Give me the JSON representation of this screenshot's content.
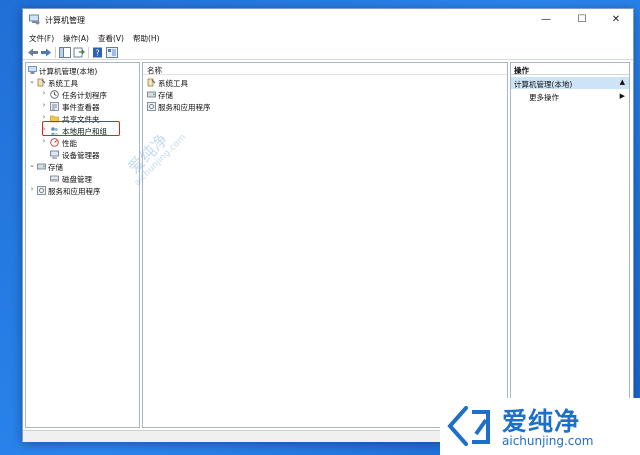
{
  "window": {
    "title": "计算机管理",
    "controls": {
      "minimize": "—",
      "maximize": "☐",
      "close": "✕"
    }
  },
  "menubar": [
    "文件(F)",
    "操作(A)",
    "查看(V)",
    "帮助(H)"
  ],
  "tree": {
    "root": "计算机管理(本地)",
    "system_tools": "系统工具",
    "task_scheduler": "任务计划程序",
    "event_viewer": "事件查看器",
    "shared_folders": "共享文件夹",
    "local_users": "本地用户和组",
    "performance": "性能",
    "device_manager": "设备管理器",
    "storage": "存储",
    "disk_management": "磁盘管理",
    "services_apps": "服务和应用程序"
  },
  "list": {
    "header": "名称",
    "items": [
      "系统工具",
      "存储",
      "服务和应用程序"
    ]
  },
  "actions": {
    "header": "操作",
    "selected": "计算机管理(本地)",
    "more": "更多操作"
  },
  "watermark": {
    "cn": "爱纯净",
    "en": "aichunjing.com"
  },
  "brand": {
    "cn": "爱纯净",
    "en": "aichunjing.com"
  },
  "colors": {
    "desktop": "#1f6fd6",
    "highlight": "#e0201d",
    "selection": "#cde4f7",
    "brand_blue": "#1e6fc8"
  }
}
